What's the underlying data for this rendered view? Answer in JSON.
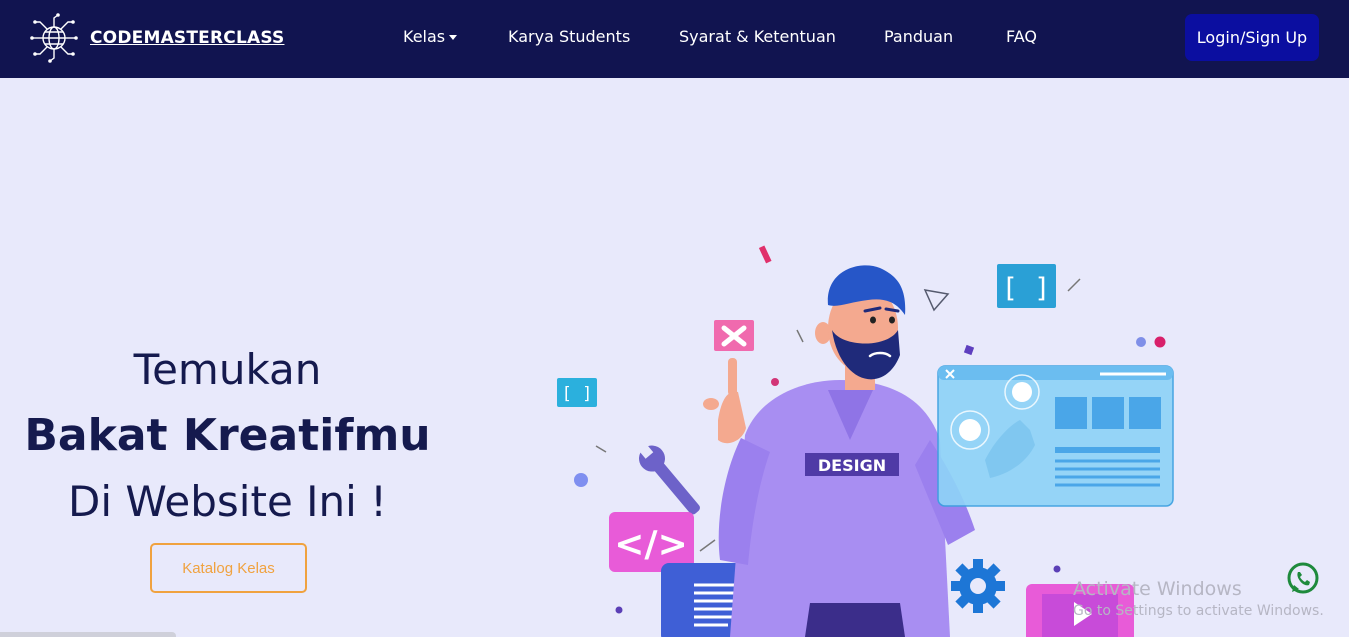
{
  "nav": {
    "brand": "CODEMASTERCLASS",
    "logo_icon": "circuit-globe-logo",
    "links": [
      "Kelas",
      "Karya Students",
      "Syarat & Ketentuan",
      "Panduan",
      "FAQ"
    ],
    "login": "Login/Sign Up"
  },
  "hero": {
    "line1": "Temukan",
    "line2": "Bakat Kreatifmu",
    "line3": "Di Website Ini !",
    "cta": "Katalog Kelas",
    "illustration": {
      "shirt_text": "DESIGN"
    }
  },
  "watermark": {
    "title": "Activate Windows",
    "subtitle": "Go to Settings to activate Windows."
  },
  "colors": {
    "nav_bg": "#111450",
    "page_bg": "#e8e9fb",
    "login_bg": "#0b0ea0",
    "heading": "#151a4e",
    "cta_border": "#f0a23f",
    "whatsapp": "#1e8a3c"
  }
}
